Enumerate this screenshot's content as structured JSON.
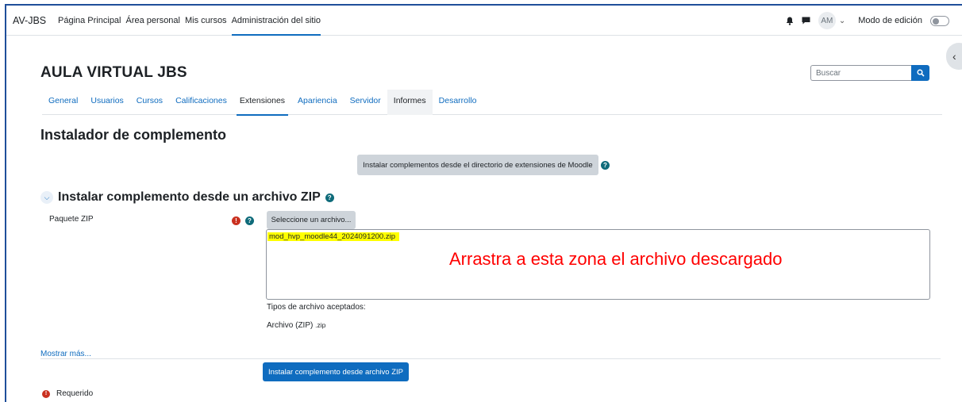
{
  "navbar": {
    "brand": "AV-JBS",
    "links": [
      {
        "label": "Página Principal",
        "active": false
      },
      {
        "label": "Área personal",
        "active": false
      },
      {
        "label": "Mis cursos",
        "active": false
      },
      {
        "label": "Administración del sitio",
        "active": true
      }
    ],
    "avatar_initials": "AM",
    "edit_mode_label": "Modo de edición",
    "icons": [
      "bell-icon",
      "chat-icon",
      "chevron-down-icon"
    ]
  },
  "header": {
    "site_title": "AULA VIRTUAL JBS",
    "search_placeholder": "Buscar"
  },
  "tabs": [
    {
      "label": "General",
      "style": "link"
    },
    {
      "label": "Usuarios",
      "style": "link"
    },
    {
      "label": "Cursos",
      "style": "link"
    },
    {
      "label": "Calificaciones",
      "style": "link"
    },
    {
      "label": "Extensiones",
      "style": "active"
    },
    {
      "label": "Apariencia",
      "style": "link"
    },
    {
      "label": "Servidor",
      "style": "link"
    },
    {
      "label": "Informes",
      "style": "shaded"
    },
    {
      "label": "Desarrollo",
      "style": "link"
    }
  ],
  "main": {
    "page_heading": "Instalador de complemento",
    "directory_button": "Instalar complementos desde el directorio de extensiones de Moodle",
    "section_title": "Instalar complemento desde un archivo ZIP",
    "zip_field": {
      "label": "Paquete ZIP",
      "choose_button": "Seleccione un archivo...",
      "file_name": "mod_hvp_moodle44_2024091200.zip",
      "dropzone_hint": "Arrastra a esta zona el archivo descargado",
      "accepted_types_label": "Tipos de archivo aceptados:",
      "accepted_type_name": "Archivo (ZIP)",
      "accepted_type_ext": ".zip"
    },
    "show_more": "Mostrar más...",
    "install_button": "Instalar complemento desde archivo ZIP",
    "required_note": "Requerido"
  },
  "colors": {
    "primary": "#0f6cbf",
    "required": "#ca3120",
    "help": "#0f6b7a",
    "highlight": "#ffff00",
    "hint_text": "#ff0000"
  }
}
